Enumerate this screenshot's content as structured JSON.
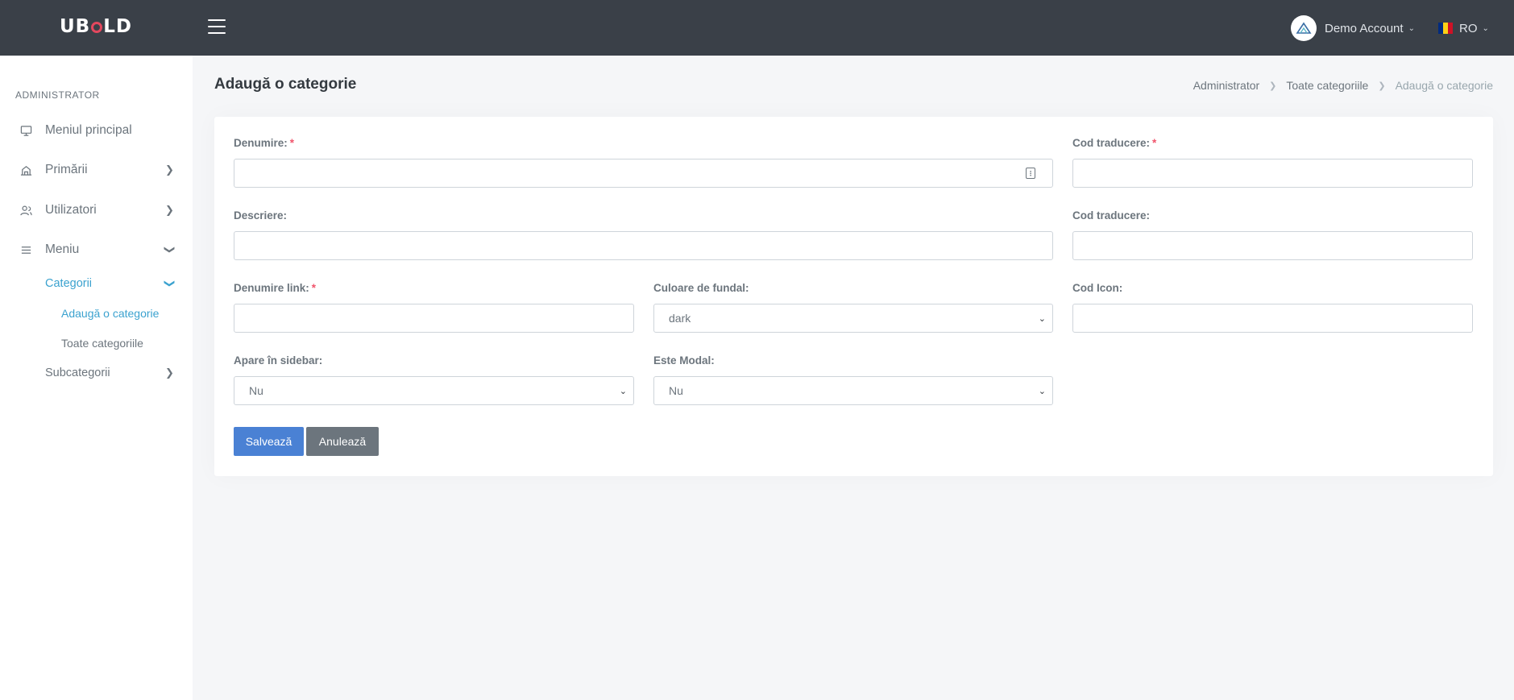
{
  "topbar": {
    "logo": {
      "before": "UB",
      "after": "LD"
    },
    "account_name": "Demo Account",
    "language": "RO",
    "icons": {
      "menu": "hamburger-icon",
      "avatar": "mountain-logo-icon",
      "flag": "romania-flag-icon"
    }
  },
  "sidebar": {
    "section_title": "ADMINISTRATOR",
    "items": [
      {
        "label": "Meniul principal",
        "icon": "monitor-icon"
      },
      {
        "label": "Primării",
        "icon": "building-icon"
      },
      {
        "label": "Utilizatori",
        "icon": "users-icon"
      },
      {
        "label": "Meniu",
        "icon": "list-icon"
      }
    ],
    "sub_items": [
      {
        "label": "Categorii",
        "active": true
      },
      {
        "label": "Subcategorii",
        "active": false
      }
    ],
    "categorii_children": [
      {
        "label": "Adaugă o categorie",
        "active": true
      },
      {
        "label": "Toate categoriile",
        "active": false
      }
    ]
  },
  "page": {
    "title": "Adaugă o categorie",
    "breadcrumb": [
      "Administrator",
      "Toate categoriile",
      "Adaugă o categorie"
    ]
  },
  "form": {
    "denumire_label": "Denumire:",
    "cod_traducere_label_1": "Cod traducere:",
    "descriere_label": "Descriere:",
    "cod_traducere_label_2": "Cod traducere:",
    "denumire_link_label": "Denumire link:",
    "culoare_label": "Culoare de fundal:",
    "culoare_value": "dark",
    "cod_icon_label": "Cod Icon:",
    "apare_sidebar_label": "Apare în sidebar:",
    "apare_sidebar_value": "Nu",
    "este_modal_label": "Este Modal:",
    "este_modal_value": "Nu",
    "required_mark": "*",
    "save_label": "Salvează",
    "cancel_label": "Anulează"
  },
  "colors": {
    "topbar": "#3a4048",
    "accent": "#3ba2cf",
    "primary_button": "#4a81d4",
    "secondary_button": "#6c757d",
    "required": "#f1556c"
  }
}
